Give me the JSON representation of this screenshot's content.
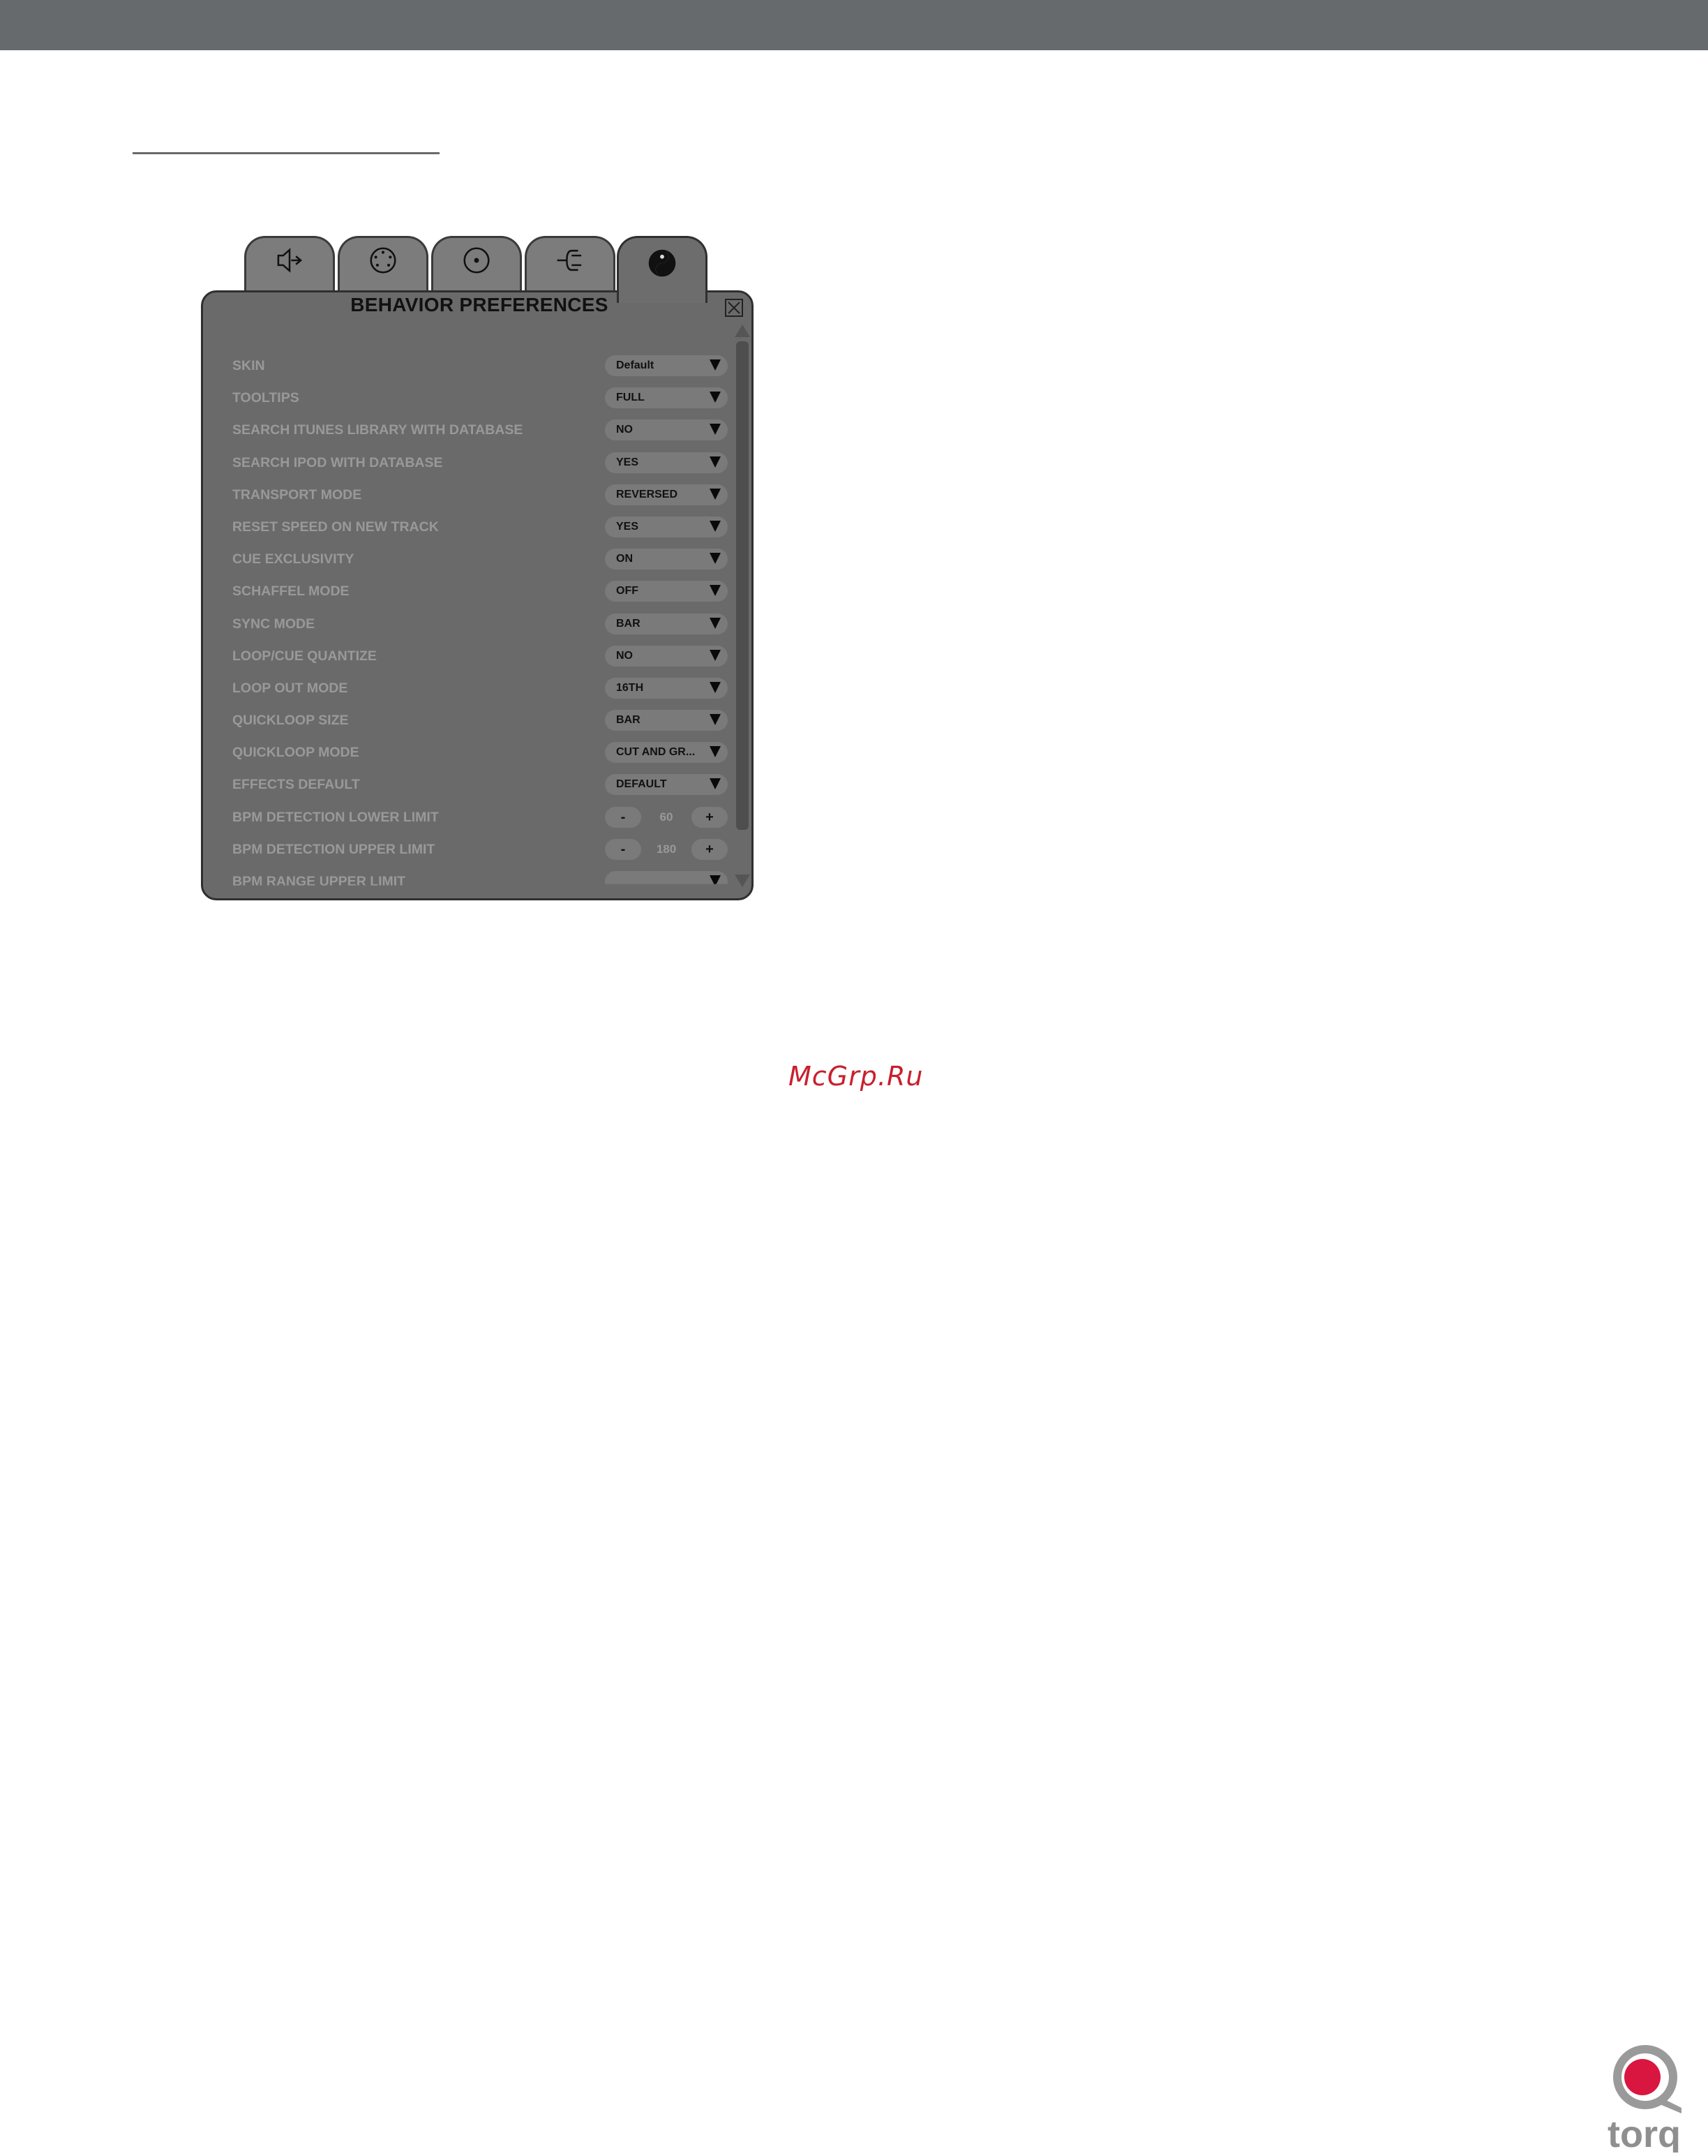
{
  "panel": {
    "title": "BEHAVIOR PREFERENCES",
    "tabs": [
      {
        "icon": "speaker-icon"
      },
      {
        "icon": "midi-connector-icon"
      },
      {
        "icon": "disc-icon"
      },
      {
        "icon": "plug-icon"
      },
      {
        "icon": "yin-yang-icon",
        "active": true
      }
    ],
    "rows": [
      {
        "label": "SKIN",
        "value": "Default"
      },
      {
        "label": "TOOLTIPS",
        "value": "FULL"
      },
      {
        "label": "SEARCH ITUNES LIBRARY WITH DATABASE",
        "value": "NO"
      },
      {
        "label": "SEARCH IPOD WITH DATABASE",
        "value": "YES"
      },
      {
        "label": "TRANSPORT MODE",
        "value": "REVERSED"
      },
      {
        "label": "RESET SPEED ON NEW TRACK",
        "value": "YES"
      },
      {
        "label": "CUE EXCLUSIVITY",
        "value": "ON"
      },
      {
        "label": "SCHAFFEL MODE",
        "value": "OFF"
      },
      {
        "label": "SYNC MODE",
        "value": "BAR"
      },
      {
        "label": "LOOP/CUE QUANTIZE",
        "value": "NO"
      },
      {
        "label": "LOOP OUT MODE",
        "value": "16TH"
      },
      {
        "label": "QUICKLOOP SIZE",
        "value": "BAR"
      },
      {
        "label": "QUICKLOOP MODE",
        "value": "CUT AND GR..."
      },
      {
        "label": "EFFECTS DEFAULT",
        "value": "DEFAULT"
      },
      {
        "label": "BPM DETECTION LOWER LIMIT",
        "minus": "-",
        "value": "60",
        "plus": "+"
      },
      {
        "label": "BPM DETECTION UPPER LIMIT",
        "minus": "-",
        "value": "180",
        "plus": "+"
      },
      {
        "label": "BPM RANGE UPPER LIMIT",
        "value": ""
      }
    ]
  },
  "watermark": "McGrp.Ru",
  "logo": {
    "text": "torq",
    "accent": "#d9163f"
  },
  "colors": {
    "top_bar": "#676a6d",
    "panel": "#6a6a6a",
    "label": "#999999"
  }
}
